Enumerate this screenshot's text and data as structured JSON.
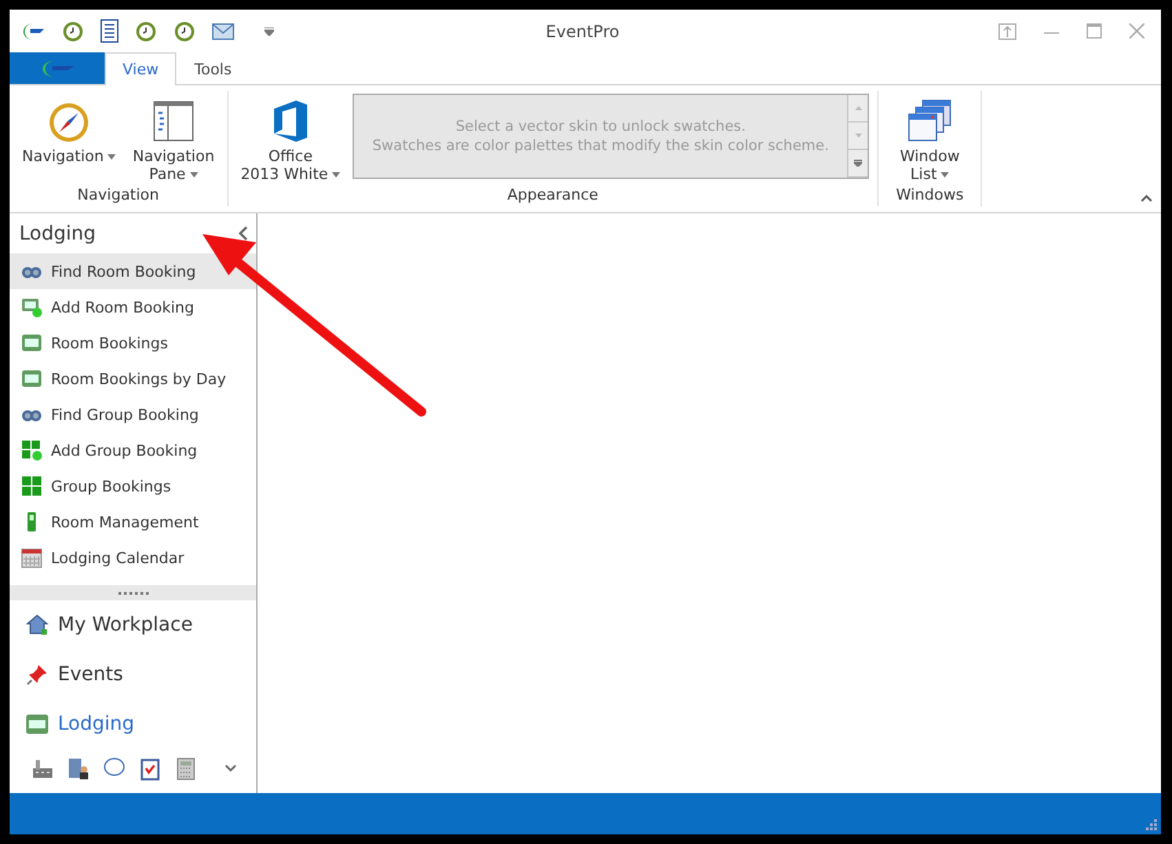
{
  "window": {
    "title": "EventPro"
  },
  "ribbon_tabs": [
    {
      "label": "View",
      "selected": true
    },
    {
      "label": "Tools",
      "selected": false
    }
  ],
  "ribbon_groups": [
    {
      "caption": "Navigation",
      "buttons": [
        {
          "label": "Navigation",
          "dropdown": true
        },
        {
          "label": "Navigation Pane",
          "dropdown": true
        }
      ]
    },
    {
      "caption": "Appearance",
      "buttons": [
        {
          "label": "Office 2013 White",
          "dropdown": true
        }
      ],
      "gallery": {
        "line_1": "Select a vector skin to unlock swatches.",
        "line_2": "Swatches are color palettes that modify the skin color scheme."
      }
    },
    {
      "caption": "Windows",
      "buttons": [
        {
          "label": "Window List",
          "dropdown": true
        }
      ]
    }
  ],
  "nav_pane": {
    "title": "Lodging",
    "items": [
      {
        "label": "Find Room Booking",
        "selected": true
      },
      {
        "label": "Add Room Booking",
        "selected": false
      },
      {
        "label": "Room Bookings",
        "selected": false
      },
      {
        "label": "Room Bookings by Day",
        "selected": false
      },
      {
        "label": "Find Group Booking",
        "selected": false
      },
      {
        "label": "Add Group Booking",
        "selected": false
      },
      {
        "label": "Group Bookings",
        "selected": false
      },
      {
        "label": "Room Management",
        "selected": false
      },
      {
        "label": "Lodging Calendar",
        "selected": false
      }
    ],
    "sections": [
      {
        "label": "My Workplace",
        "selected": false
      },
      {
        "label": "Events",
        "selected": false
      },
      {
        "label": "Lodging",
        "selected": true
      }
    ]
  }
}
